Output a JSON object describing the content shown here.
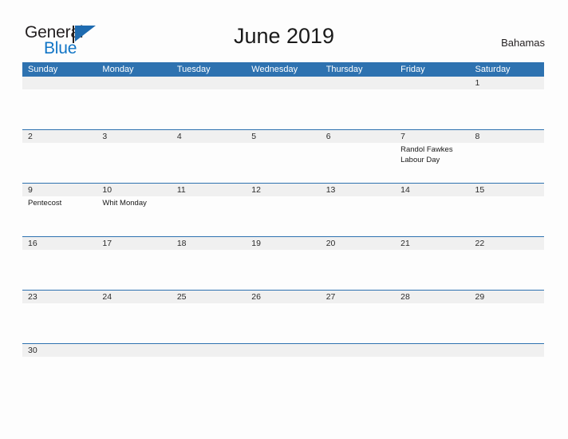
{
  "brand": {
    "name_part1": "General",
    "name_part2": "Blue",
    "sail_icon": "sail-triangle-icon",
    "colors": {
      "general": "#231f20",
      "blue": "#1175c6",
      "sail": "#1e6bb0"
    }
  },
  "header": {
    "title": "June 2019",
    "locale": "Bahamas"
  },
  "theme": {
    "header_blue": "#2e72b0",
    "row_gray": "#f0f0f0",
    "page_background": "#fdfdfd",
    "text": "#1a1a1a"
  },
  "calendar": {
    "month": "June",
    "year": "2019",
    "weekday_headers": [
      "Sunday",
      "Monday",
      "Tuesday",
      "Wednesday",
      "Thursday",
      "Friday",
      "Saturday"
    ],
    "weeks": [
      {
        "days": [
          {
            "num": "",
            "events": []
          },
          {
            "num": "",
            "events": []
          },
          {
            "num": "",
            "events": []
          },
          {
            "num": "",
            "events": []
          },
          {
            "num": "",
            "events": []
          },
          {
            "num": "",
            "events": []
          },
          {
            "num": "1",
            "events": []
          }
        ]
      },
      {
        "days": [
          {
            "num": "2",
            "events": []
          },
          {
            "num": "3",
            "events": []
          },
          {
            "num": "4",
            "events": []
          },
          {
            "num": "5",
            "events": []
          },
          {
            "num": "6",
            "events": []
          },
          {
            "num": "7",
            "events": [
              "Randol Fawkes",
              "Labour Day"
            ]
          },
          {
            "num": "8",
            "events": []
          }
        ]
      },
      {
        "days": [
          {
            "num": "9",
            "events": [
              "Pentecost"
            ]
          },
          {
            "num": "10",
            "events": [
              "Whit Monday"
            ]
          },
          {
            "num": "11",
            "events": []
          },
          {
            "num": "12",
            "events": []
          },
          {
            "num": "13",
            "events": []
          },
          {
            "num": "14",
            "events": []
          },
          {
            "num": "15",
            "events": []
          }
        ]
      },
      {
        "days": [
          {
            "num": "16",
            "events": []
          },
          {
            "num": "17",
            "events": []
          },
          {
            "num": "18",
            "events": []
          },
          {
            "num": "19",
            "events": []
          },
          {
            "num": "20",
            "events": []
          },
          {
            "num": "21",
            "events": []
          },
          {
            "num": "22",
            "events": []
          }
        ]
      },
      {
        "days": [
          {
            "num": "23",
            "events": []
          },
          {
            "num": "24",
            "events": []
          },
          {
            "num": "25",
            "events": []
          },
          {
            "num": "26",
            "events": []
          },
          {
            "num": "27",
            "events": []
          },
          {
            "num": "28",
            "events": []
          },
          {
            "num": "29",
            "events": []
          }
        ]
      },
      {
        "days": [
          {
            "num": "30",
            "events": []
          },
          {
            "num": "",
            "events": []
          },
          {
            "num": "",
            "events": []
          },
          {
            "num": "",
            "events": []
          },
          {
            "num": "",
            "events": []
          },
          {
            "num": "",
            "events": []
          },
          {
            "num": "",
            "events": []
          }
        ]
      }
    ]
  }
}
